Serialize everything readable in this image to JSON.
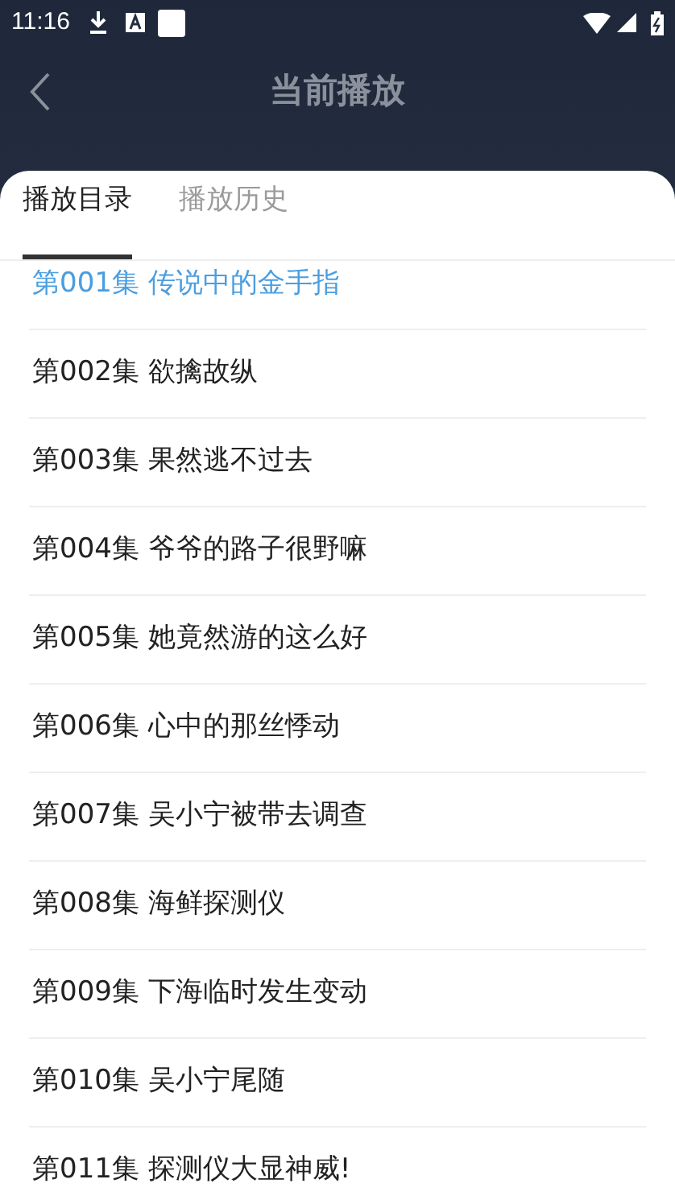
{
  "status_bar": {
    "time": "11:16"
  },
  "header": {
    "title": "当前播放"
  },
  "tabs": [
    {
      "label": "播放目录",
      "selected": true
    },
    {
      "label": "播放历史",
      "selected": false
    }
  ],
  "episodes": [
    {
      "label": "第001集 传说中的金手指",
      "selected": true
    },
    {
      "label": "第002集 欲擒故纵",
      "selected": false
    },
    {
      "label": "第003集 果然逃不过去",
      "selected": false
    },
    {
      "label": "第004集 爷爷的路子很野嘛",
      "selected": false
    },
    {
      "label": "第005集 她竟然游的这么好",
      "selected": false
    },
    {
      "label": "第006集 心中的那丝悸动",
      "selected": false
    },
    {
      "label": "第007集 吴小宁被带去调查",
      "selected": false
    },
    {
      "label": "第008集 海鲜探测仪",
      "selected": false
    },
    {
      "label": "第009集 下海临时发生变动",
      "selected": false
    },
    {
      "label": "第010集 吴小宁尾随",
      "selected": false
    },
    {
      "label": "第011集 探测仪大显神威!",
      "selected": false
    }
  ]
}
